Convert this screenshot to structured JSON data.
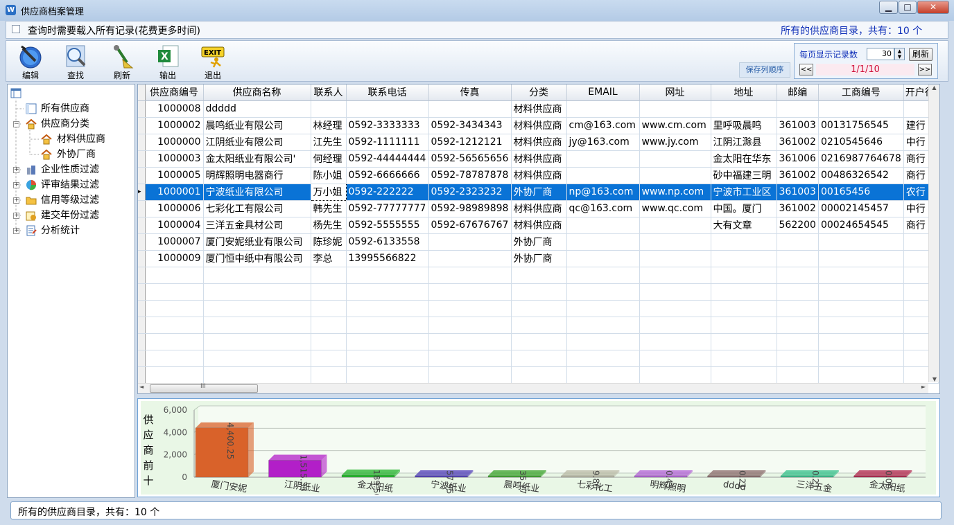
{
  "window": {
    "title": "供应商档案管理",
    "min_label": "▁",
    "max_label": "□",
    "close_label": "✕"
  },
  "topbar": {
    "checkbox_label": "查询时需要载入所有记录(花费更多时间)",
    "summary": "所有的供应商目录，共有：10  个"
  },
  "toolbar": {
    "edit": "编辑",
    "find": "查找",
    "refresh": "刷新",
    "export": "输出",
    "exit": "退出",
    "save_order": "保存列顺序"
  },
  "pager": {
    "per_page_label": "每页显示记录数",
    "per_page_value": "30",
    "refresh": "刷新",
    "prev": "<<",
    "next": ">>",
    "indicator": "1/1/10"
  },
  "tree": {
    "root_icon": "grid-icon",
    "items": [
      {
        "label": "所有供应商"
      },
      {
        "label": "供应商分类"
      },
      {
        "label": "材料供应商"
      },
      {
        "label": "外协厂商"
      },
      {
        "label": "企业性质过滤"
      },
      {
        "label": "评审结果过滤"
      },
      {
        "label": "信用等级过滤"
      },
      {
        "label": "建交年份过滤"
      },
      {
        "label": "分析统计"
      }
    ]
  },
  "grid": {
    "columns": [
      "供应商编号",
      "供应商名称",
      "联系人",
      "联系电话",
      "传真",
      "分类",
      "EMAIL",
      "网址",
      "地址",
      "邮编",
      "工商编号",
      "开户行"
    ],
    "rows": [
      [
        "1000008",
        "ddddd",
        "",
        "",
        "",
        "材料供应商",
        "",
        "",
        "",
        "",
        "",
        ""
      ],
      [
        "1000002",
        "晨鸣纸业有限公司",
        "林经理",
        "0592-3333333",
        "0592-3434343",
        "材料供应商",
        "cm@163.com",
        "www.cm.com",
        "里呼吸晨鸣",
        "361003",
        "00131756545",
        "建行"
      ],
      [
        "1000000",
        "江阴纸业有限公司",
        "江先生",
        "0592-1111111",
        "0592-1212121",
        "材料供应商",
        "jy@163.com",
        "www.jy.com",
        "江阴江滁县",
        "361002",
        "0210545646",
        "中行"
      ],
      [
        "1000003",
        "金太阳纸业有限公司'",
        "何经理",
        "0592-44444444",
        "0592-56565656",
        "材料供应商",
        "",
        "",
        "金太阳在华东",
        "361006",
        "0216987764678",
        "商行"
      ],
      [
        "1000005",
        "明辉照明电器商行",
        "陈小姐",
        "0592-6666666",
        "0592-78787878",
        "材料供应商",
        "",
        "",
        "砂中福建三明",
        "361002",
        "00486326542",
        "商行"
      ],
      [
        "1000001",
        "宁波纸业有限公司",
        "万小姐",
        "0592-222222",
        "0592-2323232",
        "外协厂商",
        "np@163.com",
        "www.np.com",
        "宁波市工业区",
        "361003",
        "00165456",
        "农行"
      ],
      [
        "1000006",
        "七彩化工有限公司",
        "韩先生",
        "0592-77777777",
        "0592-98989898",
        "材料供应商",
        "qc@163.com",
        "www.qc.com",
        "中国。厦门",
        "361002",
        "00002145457",
        "中行"
      ],
      [
        "1000004",
        "三洋五金具材公司",
        "杨先生",
        "0592-5555555",
        "0592-67676767",
        "材料供应商",
        "",
        "",
        "大有文章",
        "562200",
        "00024654545",
        "商行"
      ],
      [
        "1000007",
        "厦门安妮纸业有限公司",
        "陈珍妮",
        "0592-6133558",
        "",
        "外协厂商",
        "",
        "",
        "",
        "",
        "",
        ""
      ],
      [
        "1000009",
        "厦门恒中纸中有限公司",
        "李总",
        "13995566822",
        "",
        "外协厂商",
        "",
        "",
        "",
        "",
        "",
        ""
      ]
    ],
    "selected_row": 5,
    "hscroll_label": "III"
  },
  "chart_data": {
    "type": "bar",
    "ylabel": "供应商前十",
    "ylim": [
      0,
      6000
    ],
    "yticks": [
      "6,000",
      "4,000",
      "2,000",
      "0"
    ],
    "categories": [
      "厦门安妮",
      "江阴纸业",
      "金太阳纸",
      "宁波纸业",
      "晨鸣纸业",
      "七彩化工",
      "明辉照明",
      "dddd",
      "三洋五金",
      "金太阳纸"
    ],
    "values": [
      4400.25,
      1515.33,
      189.5,
      57.95,
      35.77,
      9.86,
      0.43,
      0.21,
      0.21,
      0.0
    ],
    "value_labels": [
      "4,400.25",
      "1,515.33",
      "189.50",
      "57.95",
      "35.77",
      "9.86",
      "0.43",
      "0.21",
      "0.21",
      "0.00"
    ],
    "colors": [
      "#d9622a",
      "#b21fc8",
      "#22b32a",
      "#4e3bb8",
      "#3aa32a",
      "#b9b9a6",
      "#b060d6",
      "#8a6a6a",
      "#33c08a",
      "#b0224a"
    ]
  },
  "status": {
    "text": "所有的供应商目录，共有：10  个"
  }
}
